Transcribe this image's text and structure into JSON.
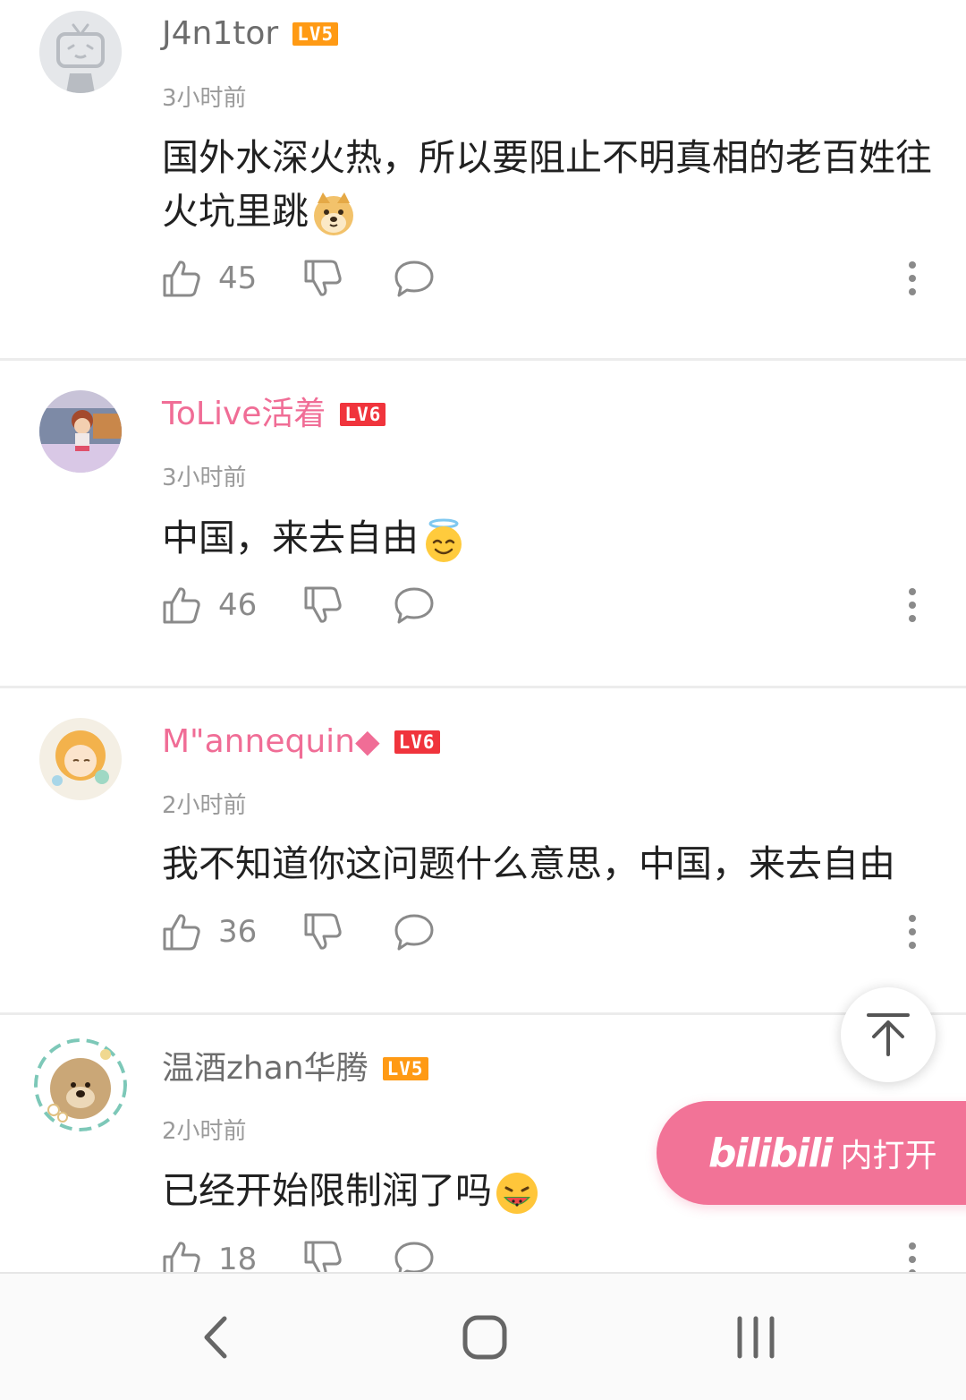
{
  "comments": [
    {
      "username": "J4n1tor",
      "level": "LV5",
      "time": "3小时前",
      "text": "国外水深火热，所以要阻止不明真相的老百姓往火坑里跳",
      "emoji": "doge-emoji",
      "likes": "45"
    },
    {
      "username": "ToLive活着",
      "level": "LV6",
      "time": "3小时前",
      "text": "中国，来去自由",
      "emoji": "halo-smile-emoji",
      "likes": "46"
    },
    {
      "username": "M\"annequin◆",
      "level": "LV6",
      "time": "2小时前",
      "text": "我不知道你这问题什么意思，中国，来去自由",
      "emoji": "",
      "likes": "36"
    },
    {
      "username": "温酒zhan华腾",
      "level": "LV5",
      "time": "2小时前",
      "text": "已经开始限制润了吗",
      "emoji": "watermelon-eating-emoji",
      "likes": "18"
    }
  ],
  "floating": {
    "brand": "bilibili",
    "open_label": "内打开"
  },
  "colors": {
    "pink_username": "#f06d96",
    "lv5": "#ff9a14",
    "lv6": "#f0343c",
    "open_app_bg": "#f27397"
  },
  "icons": {
    "like": "thumbs-up-icon",
    "dislike": "thumbs-down-icon",
    "reply": "speech-bubble-icon",
    "more": "more-vertical-icon",
    "back_to_top": "arrow-up-icon",
    "nav_back": "chevron-left-icon",
    "nav_home": "home-square-icon",
    "nav_recents": "recents-icon"
  }
}
